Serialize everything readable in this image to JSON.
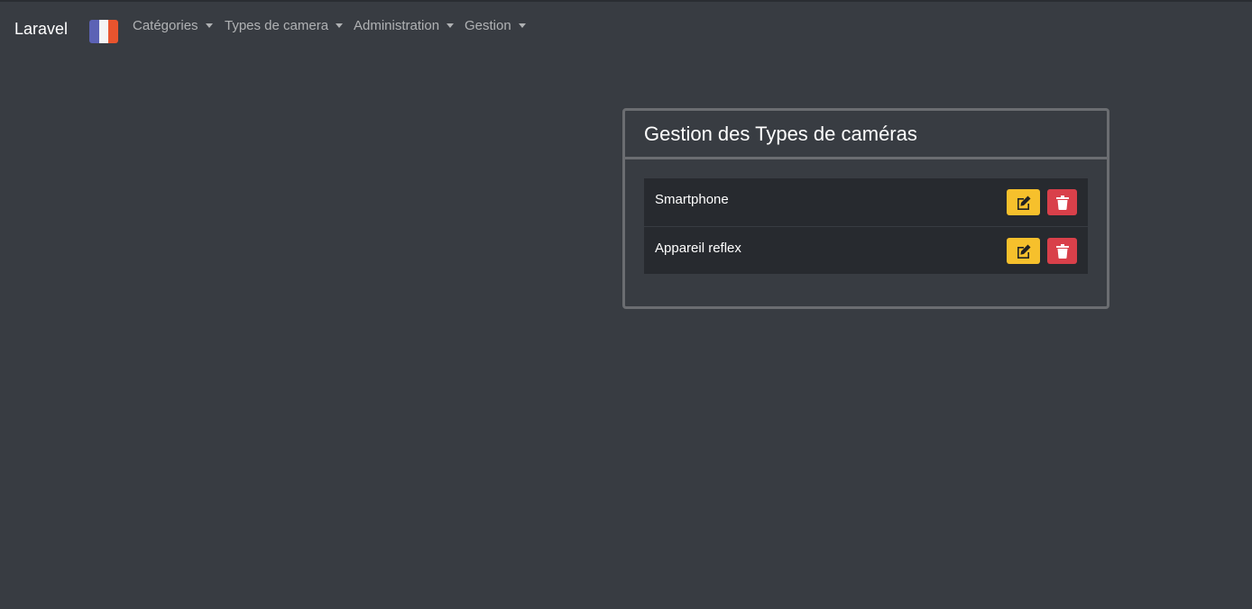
{
  "navbar": {
    "brand": "Laravel",
    "language_flag": "flag-fr",
    "menus": [
      {
        "label": "Catégories"
      },
      {
        "label": "Types de camera"
      },
      {
        "label": "Administration"
      },
      {
        "label": "Gestion"
      }
    ]
  },
  "card": {
    "title": "Gestion des Types de caméras",
    "items": [
      {
        "label": "Smartphone",
        "edit_icon": "edit-icon",
        "delete_icon": "trash-icon"
      },
      {
        "label": "Appareil reflex",
        "edit_icon": "edit-icon",
        "delete_icon": "trash-icon"
      }
    ]
  },
  "colors": {
    "background": "#383c42",
    "edit": "#f6c02c",
    "delete": "#d9404a",
    "row": "#272a2f",
    "flag_blue": "#5c62b5",
    "flag_white": "#f4f4f4",
    "flag_red": "#e8542e"
  }
}
